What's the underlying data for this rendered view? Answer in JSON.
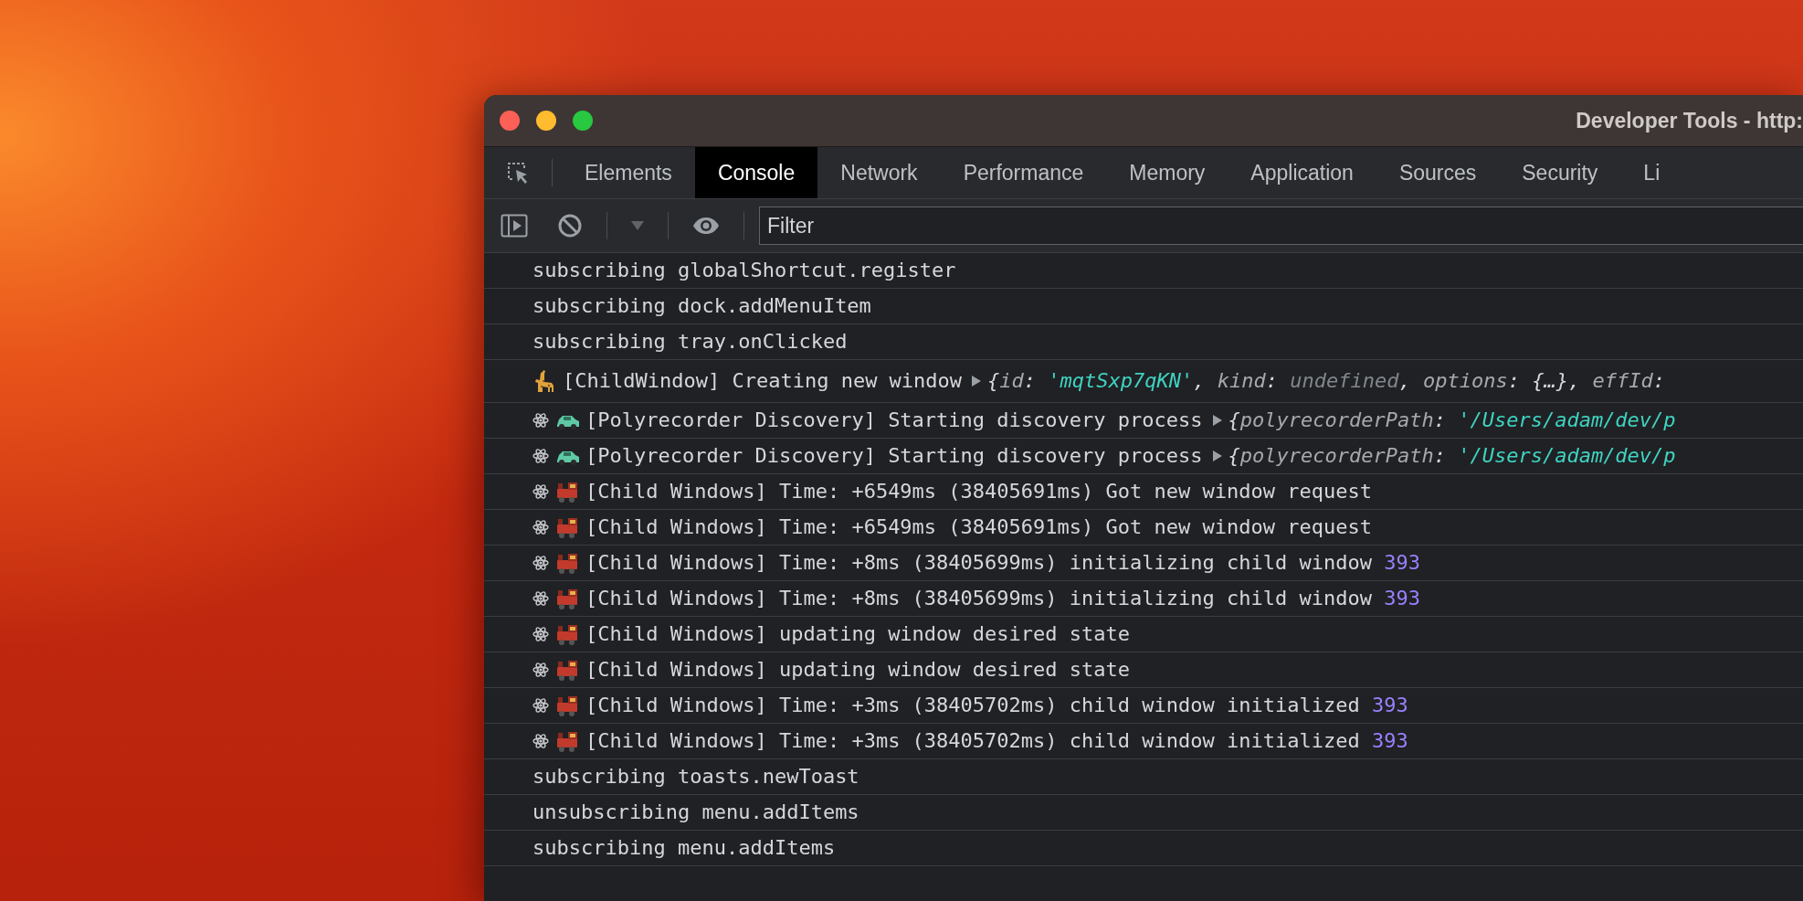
{
  "window": {
    "title": "Developer Tools - http:"
  },
  "tabs": [
    {
      "label": "Elements",
      "selected": false
    },
    {
      "label": "Console",
      "selected": true
    },
    {
      "label": "Network",
      "selected": false
    },
    {
      "label": "Performance",
      "selected": false
    },
    {
      "label": "Memory",
      "selected": false
    },
    {
      "label": "Application",
      "selected": false
    },
    {
      "label": "Sources",
      "selected": false
    },
    {
      "label": "Security",
      "selected": false
    },
    {
      "label": "Li",
      "selected": false
    }
  ],
  "filter": {
    "placeholder": "Filter"
  },
  "console": {
    "rows": [
      {
        "kind": "plain",
        "message": "subscribing globalShortcut.register"
      },
      {
        "kind": "plain",
        "message": "subscribing dock.addMenuItem"
      },
      {
        "kind": "plain",
        "message": "subscribing tray.onClicked"
      },
      {
        "kind": "giraffe",
        "message": "[ChildWindow] Creating new window",
        "preview": {
          "expanded": false,
          "parts": [
            {
              "kind": "punct",
              "text": "{"
            },
            {
              "kind": "key",
              "text": "id"
            },
            {
              "kind": "punct",
              "text": ": "
            },
            {
              "kind": "string",
              "text": "'mqtSxp7qKN'"
            },
            {
              "kind": "punct",
              "text": ", "
            },
            {
              "kind": "key",
              "text": "kind"
            },
            {
              "kind": "punct",
              "text": ": "
            },
            {
              "kind": "undefined",
              "text": "undefined"
            },
            {
              "kind": "punct",
              "text": ", "
            },
            {
              "kind": "key",
              "text": "options"
            },
            {
              "kind": "punct",
              "text": ": {…}, "
            },
            {
              "kind": "key",
              "text": "effId"
            },
            {
              "kind": "punct",
              "text": ":"
            }
          ]
        }
      },
      {
        "kind": "discovery",
        "message": "[Polyrecorder Discovery] Starting discovery process",
        "preview": {
          "expanded": false,
          "parts": [
            {
              "kind": "punct",
              "text": "{"
            },
            {
              "kind": "key",
              "text": "polyrecorderPath"
            },
            {
              "kind": "punct",
              "text": ": "
            },
            {
              "kind": "string",
              "text": "'/Users/adam/dev/p"
            }
          ]
        }
      },
      {
        "kind": "discovery",
        "message": "[Polyrecorder Discovery] Starting discovery process",
        "preview": {
          "expanded": false,
          "parts": [
            {
              "kind": "punct",
              "text": "{"
            },
            {
              "kind": "key",
              "text": "polyrecorderPath"
            },
            {
              "kind": "punct",
              "text": ": "
            },
            {
              "kind": "string",
              "text": "'/Users/adam/dev/p"
            }
          ]
        }
      },
      {
        "kind": "child-windows",
        "message": "[Child Windows] Time: +6549ms (38405691ms) Got new window request"
      },
      {
        "kind": "child-windows",
        "message": "[Child Windows] Time: +6549ms (38405691ms) Got new window request"
      },
      {
        "kind": "child-windows",
        "message": "[Child Windows] Time: +8ms (38405699ms) initializing child window",
        "number": "393"
      },
      {
        "kind": "child-windows",
        "message": "[Child Windows] Time: +8ms (38405699ms) initializing child window",
        "number": "393"
      },
      {
        "kind": "child-windows",
        "message": "[Child Windows] updating window desired state"
      },
      {
        "kind": "child-windows",
        "message": "[Child Windows] updating window desired state"
      },
      {
        "kind": "child-windows",
        "message": "[Child Windows] Time: +3ms (38405702ms) child window initialized",
        "number": "393"
      },
      {
        "kind": "child-windows",
        "message": "[Child Windows] Time: +3ms (38405702ms) child window initialized",
        "number": "393"
      },
      {
        "kind": "plain",
        "message": "subscribing toasts.newToast"
      },
      {
        "kind": "plain",
        "message": "unsubscribing menu.addItems"
      },
      {
        "kind": "plain",
        "message": "subscribing menu.addItems"
      }
    ]
  }
}
